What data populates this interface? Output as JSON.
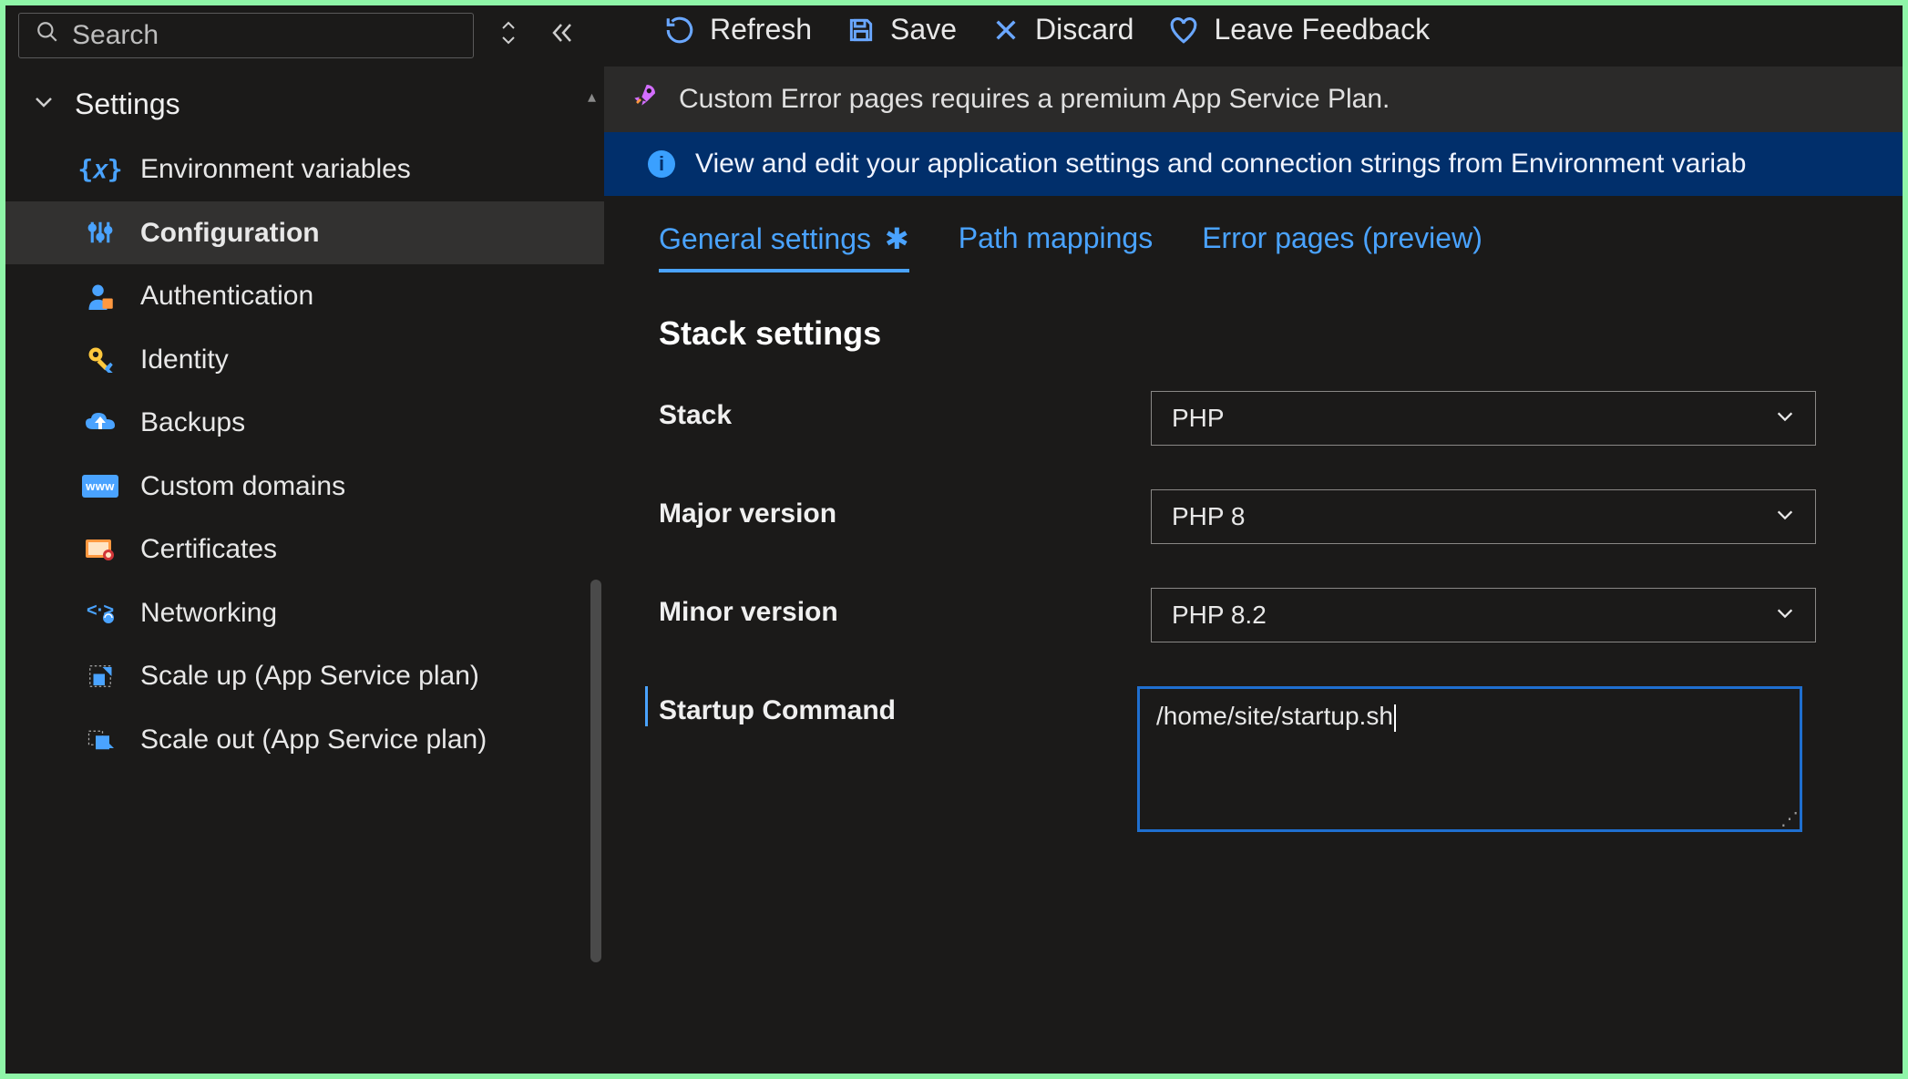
{
  "search": {
    "placeholder": "Search"
  },
  "sidebar": {
    "section_label": "Settings",
    "items": [
      {
        "label": "Environment variables"
      },
      {
        "label": "Configuration"
      },
      {
        "label": "Authentication"
      },
      {
        "label": "Identity"
      },
      {
        "label": "Backups"
      },
      {
        "label": "Custom domains"
      },
      {
        "label": "Certificates"
      },
      {
        "label": "Networking"
      },
      {
        "label": "Scale up (App Service plan)"
      },
      {
        "label": "Scale out (App Service plan)"
      }
    ]
  },
  "toolbar": {
    "refresh": "Refresh",
    "save": "Save",
    "discard": "Discard",
    "feedback": "Leave Feedback"
  },
  "banners": {
    "premium": "Custom Error pages requires a premium App Service Plan.",
    "info": "View and edit your application settings and connection strings from Environment variab"
  },
  "tabs": {
    "general": "General settings",
    "dirty_mark": "✱",
    "path": "Path mappings",
    "error": "Error pages (preview)"
  },
  "section_title": "Stack settings",
  "form": {
    "stack_label": "Stack",
    "stack_value": "PHP",
    "major_label": "Major version",
    "major_value": "PHP 8",
    "minor_label": "Minor version",
    "minor_value": "PHP 8.2",
    "startup_label": "Startup Command",
    "startup_value": "/home/site/startup.sh"
  }
}
